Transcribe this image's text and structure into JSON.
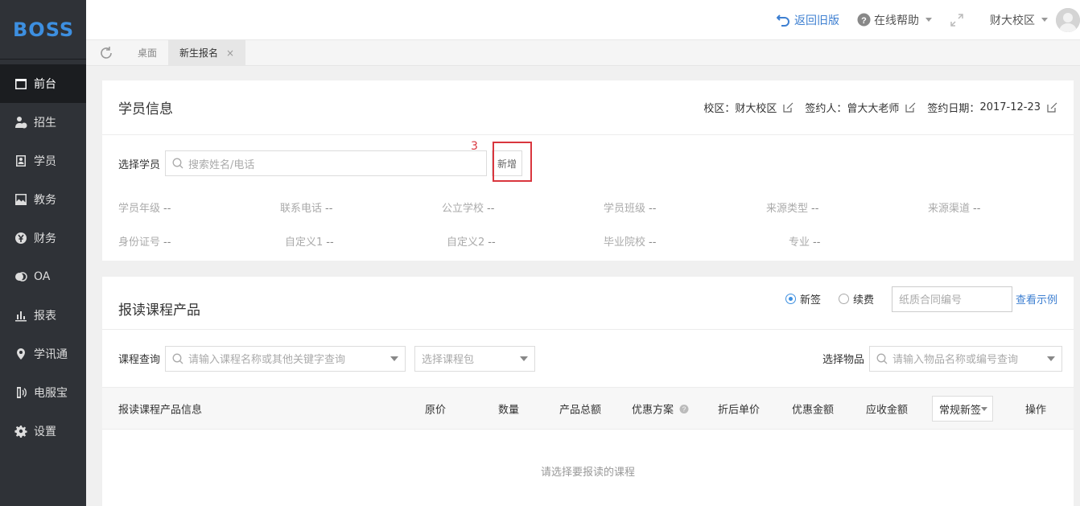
{
  "brand": {
    "logo": "BOSS"
  },
  "sidebar": {
    "items": [
      {
        "label": "前台",
        "icon": "calendar-icon"
      },
      {
        "label": "招生",
        "icon": "user-add-icon"
      },
      {
        "label": "学员",
        "icon": "contact-card-icon"
      },
      {
        "label": "教务",
        "icon": "picture-icon"
      },
      {
        "label": "财务",
        "icon": "yen-icon"
      },
      {
        "label": "OA",
        "icon": "toggle-icon"
      },
      {
        "label": "报表",
        "icon": "bar-chart-icon"
      },
      {
        "label": "学讯通",
        "icon": "location-pin-icon"
      },
      {
        "label": "电服宝",
        "icon": "phone-icon"
      },
      {
        "label": "设置",
        "icon": "gear-icon"
      }
    ]
  },
  "topbar": {
    "back_old": "返回旧版",
    "help": "在线帮助",
    "campus": "财大校区"
  },
  "tabs": {
    "desktop": "桌面",
    "enroll": "新生报名",
    "close": "×"
  },
  "student": {
    "title": "学员信息",
    "campus_label": "校区：",
    "campus_value": "财大校区",
    "signer_label": "签约人：",
    "signer_value": "曾大大老师",
    "date_label": "签约日期：",
    "date_value": "2017-12-23",
    "select_label": "选择学员",
    "search_placeholder": "搜索姓名/电话",
    "add_button": "新增",
    "annotation": "3",
    "fields": [
      {
        "label": "学员年级",
        "value": "--"
      },
      {
        "label": "联系电话",
        "value": "--"
      },
      {
        "label": "公立学校",
        "value": "--"
      },
      {
        "label": "学员班级",
        "value": "--"
      },
      {
        "label": "来源类型",
        "value": "--"
      },
      {
        "label": "来源渠道",
        "value": "--"
      },
      {
        "label": "身份证号",
        "value": "--"
      },
      {
        "label": "自定义1",
        "value": "--"
      },
      {
        "label": "自定义2",
        "value": "--"
      },
      {
        "label": "毕业院校",
        "value": "--"
      },
      {
        "label": "专业",
        "value": "--"
      }
    ]
  },
  "course": {
    "title": "报读课程产品",
    "radio_new": "新签",
    "radio_renew": "续费",
    "radio_selected": "新签",
    "contract_placeholder": "纸质合同编号",
    "view_example": "查看示例",
    "query_label": "课程查询",
    "query_placeholder": "请输入课程名称或其他关键字查询",
    "package_placeholder": "选择课程包",
    "item_label": "选择物品",
    "item_placeholder": "请输入物品名称或编号查询",
    "columns": [
      "报读课程产品信息",
      "原价",
      "数量",
      "产品总额",
      "优惠方案",
      "折后单价",
      "优惠金额",
      "应收金额",
      "操作"
    ],
    "column_select": "常规新签",
    "empty": "请选择要报读的课程"
  }
}
